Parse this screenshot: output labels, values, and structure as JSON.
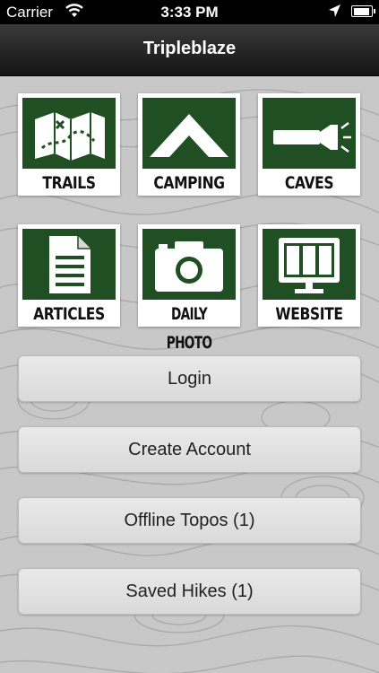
{
  "status": {
    "carrier": "Carrier",
    "time": "3:33 PM",
    "battery_level": 0.95
  },
  "nav": {
    "title": "Tripleblaze"
  },
  "tiles": [
    {
      "label": "TRAILS",
      "icon": "map-icon"
    },
    {
      "label": "CAMPING",
      "icon": "tent-icon"
    },
    {
      "label": "CAVES",
      "icon": "flashlight-icon"
    },
    {
      "label": "ARTICLES",
      "icon": "document-icon"
    },
    {
      "label": "DAILY PHOTO",
      "icon": "camera-icon"
    },
    {
      "label": "WEBSITE",
      "icon": "monitor-icon"
    }
  ],
  "buttons": {
    "login": "Login",
    "create_account": "Create Account",
    "offline_topos": "Offline Topos (1)",
    "saved_hikes": "Saved Hikes (1)"
  },
  "colors": {
    "tile_green": "#1f4f22",
    "background": "#c8c8c8"
  }
}
